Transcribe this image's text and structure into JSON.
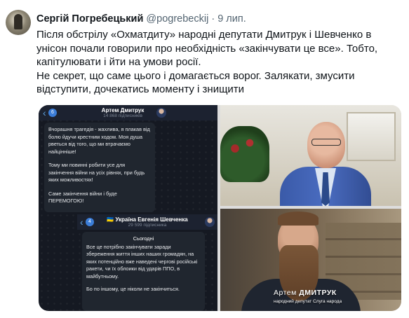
{
  "tweet": {
    "author_name": "Сергій Погребецький",
    "handle": "@pogrebeckij",
    "separator": "·",
    "date": "9 лип.",
    "text_para1": "Після обстрілу «Охматдиту» народні депутати Дмитрук і Шевченко в унісон почали говорили про необхідність «закінчувати це все». Тобто, капітулювати і йти на умови росії.",
    "text_para2": "Не секрет, що саме цього і домагається ворог. Залякати, змусити відступити, дочекатись моменту і знищити"
  },
  "media": {
    "telegram1": {
      "back_badge": "6",
      "title": "Артем Дмитрук",
      "subscribers": "14 868 підписників",
      "paragraphs": [
        "Вчорашня трагедія - жахлива, я плакав від болю йдучи крестним ходом. Моя душа рветься від того, що ми втрачаємо найцінніше!",
        "Тому ми повинні робити усе для закінчення війни на усіх рівнях, при будь яких можливостях!",
        "Саме закінчення війни і буде ПЕРЕМОГОЮ!"
      ]
    },
    "telegram2": {
      "back_badge": "4",
      "title": "🇺🇦 Україна Евгенія Шевченка",
      "subscribers": "29 599 підписника",
      "when": "Сьогодні",
      "paragraphs": [
        "Все це потрібно закінчувати заради збереження життя інших наших громадян, на яких потенційно вже наведені чергові російські ракети, чи їх облоики від ударів ППО, в майбутньому.",
        "Бо по іншому, це ніколи не закінчиться."
      ]
    },
    "photo_caption_name_first": "Артем",
    "photo_caption_name_last": "ДМИТРУК",
    "photo_caption_role": "народний депутат Слуга народа"
  }
}
